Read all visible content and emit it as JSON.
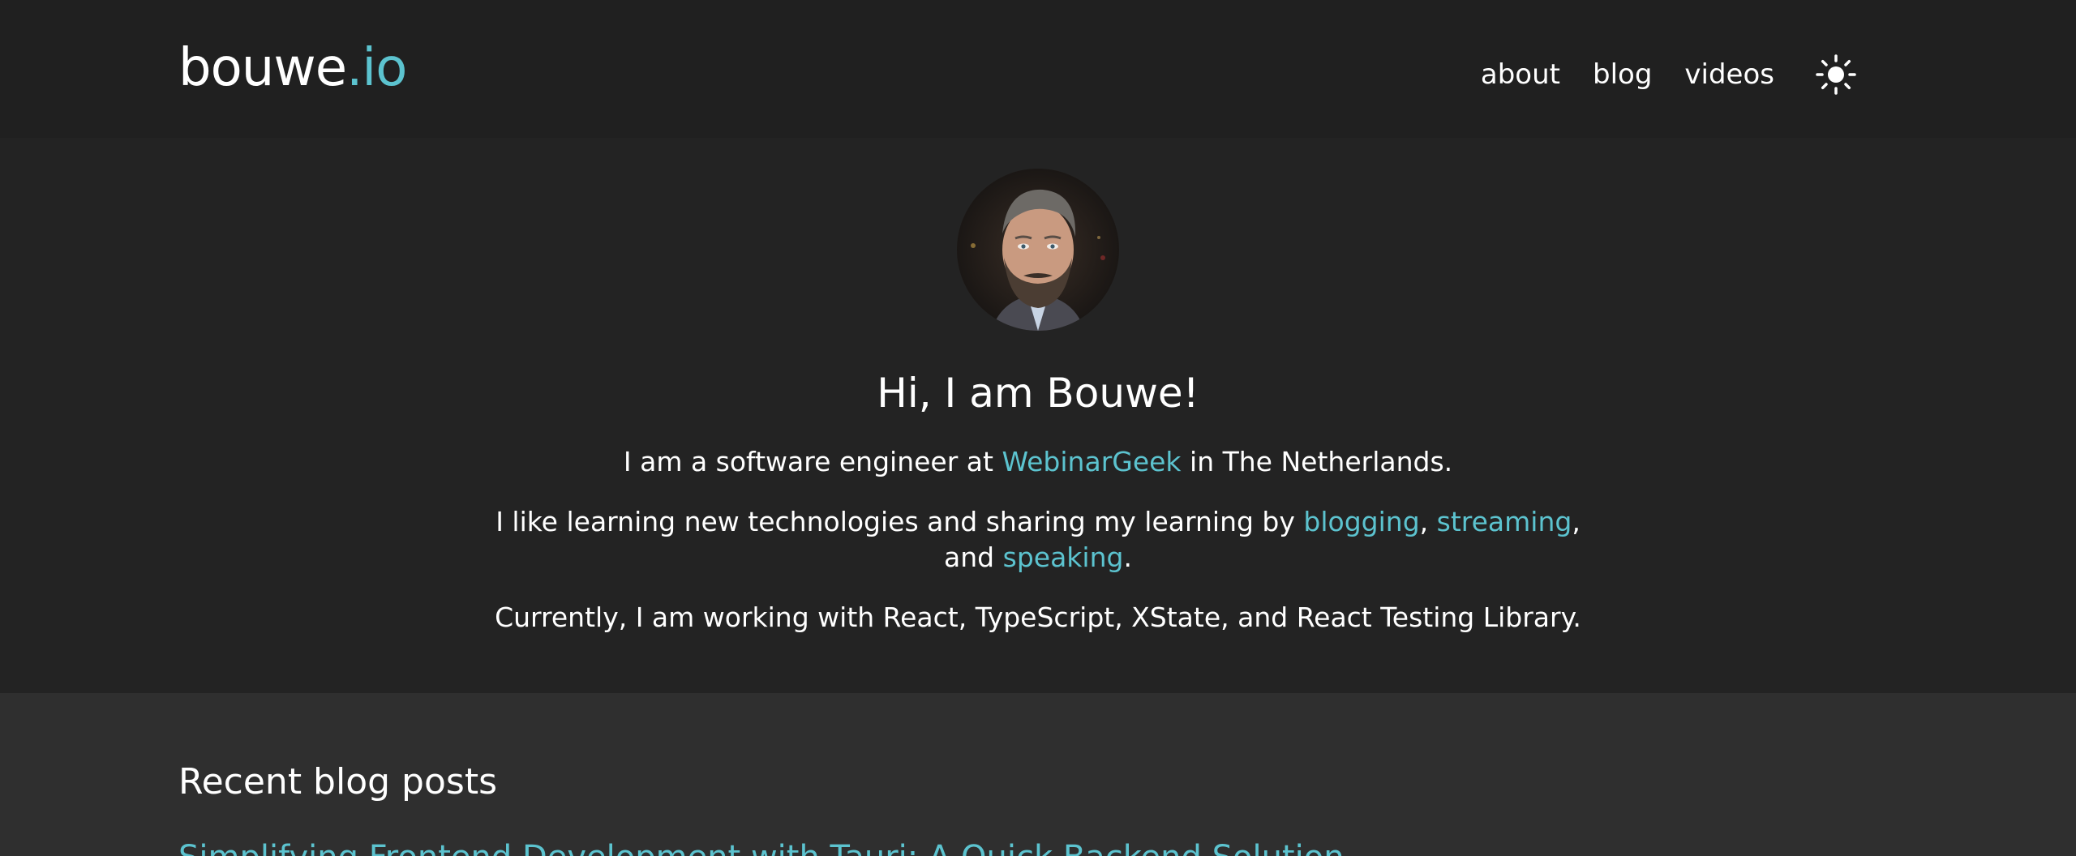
{
  "header": {
    "logo_main": "bouwe",
    "logo_accent": ".io",
    "nav": [
      {
        "label": "about"
      },
      {
        "label": "blog"
      },
      {
        "label": "videos"
      }
    ],
    "theme_toggle_icon": "sun-icon"
  },
  "hero": {
    "headline": "Hi, I am Bouwe!",
    "p1_before": "I am a software engineer at ",
    "p1_link": "WebinarGeek",
    "p1_after": " in The Netherlands.",
    "p2_before": "I like learning new technologies and sharing my learning by ",
    "p2_link1": "blogging",
    "p2_sep1": ", ",
    "p2_link2": "streaming",
    "p2_sep2": ",",
    "p2_and": "and ",
    "p2_link3": "speaking",
    "p2_end": ".",
    "p3": "Currently, I am working with React, TypeScript, XState, and React Testing Library."
  },
  "recent": {
    "title": "Recent blog posts",
    "first_post": "Simplifying Frontend Development with Tauri: A Quick Backend Solution"
  },
  "colors": {
    "accent": "#5cc3cf",
    "header_bg": "#202020",
    "hero_bg": "#232323",
    "recent_bg": "#2f2f2f",
    "text": "#ffffff"
  }
}
